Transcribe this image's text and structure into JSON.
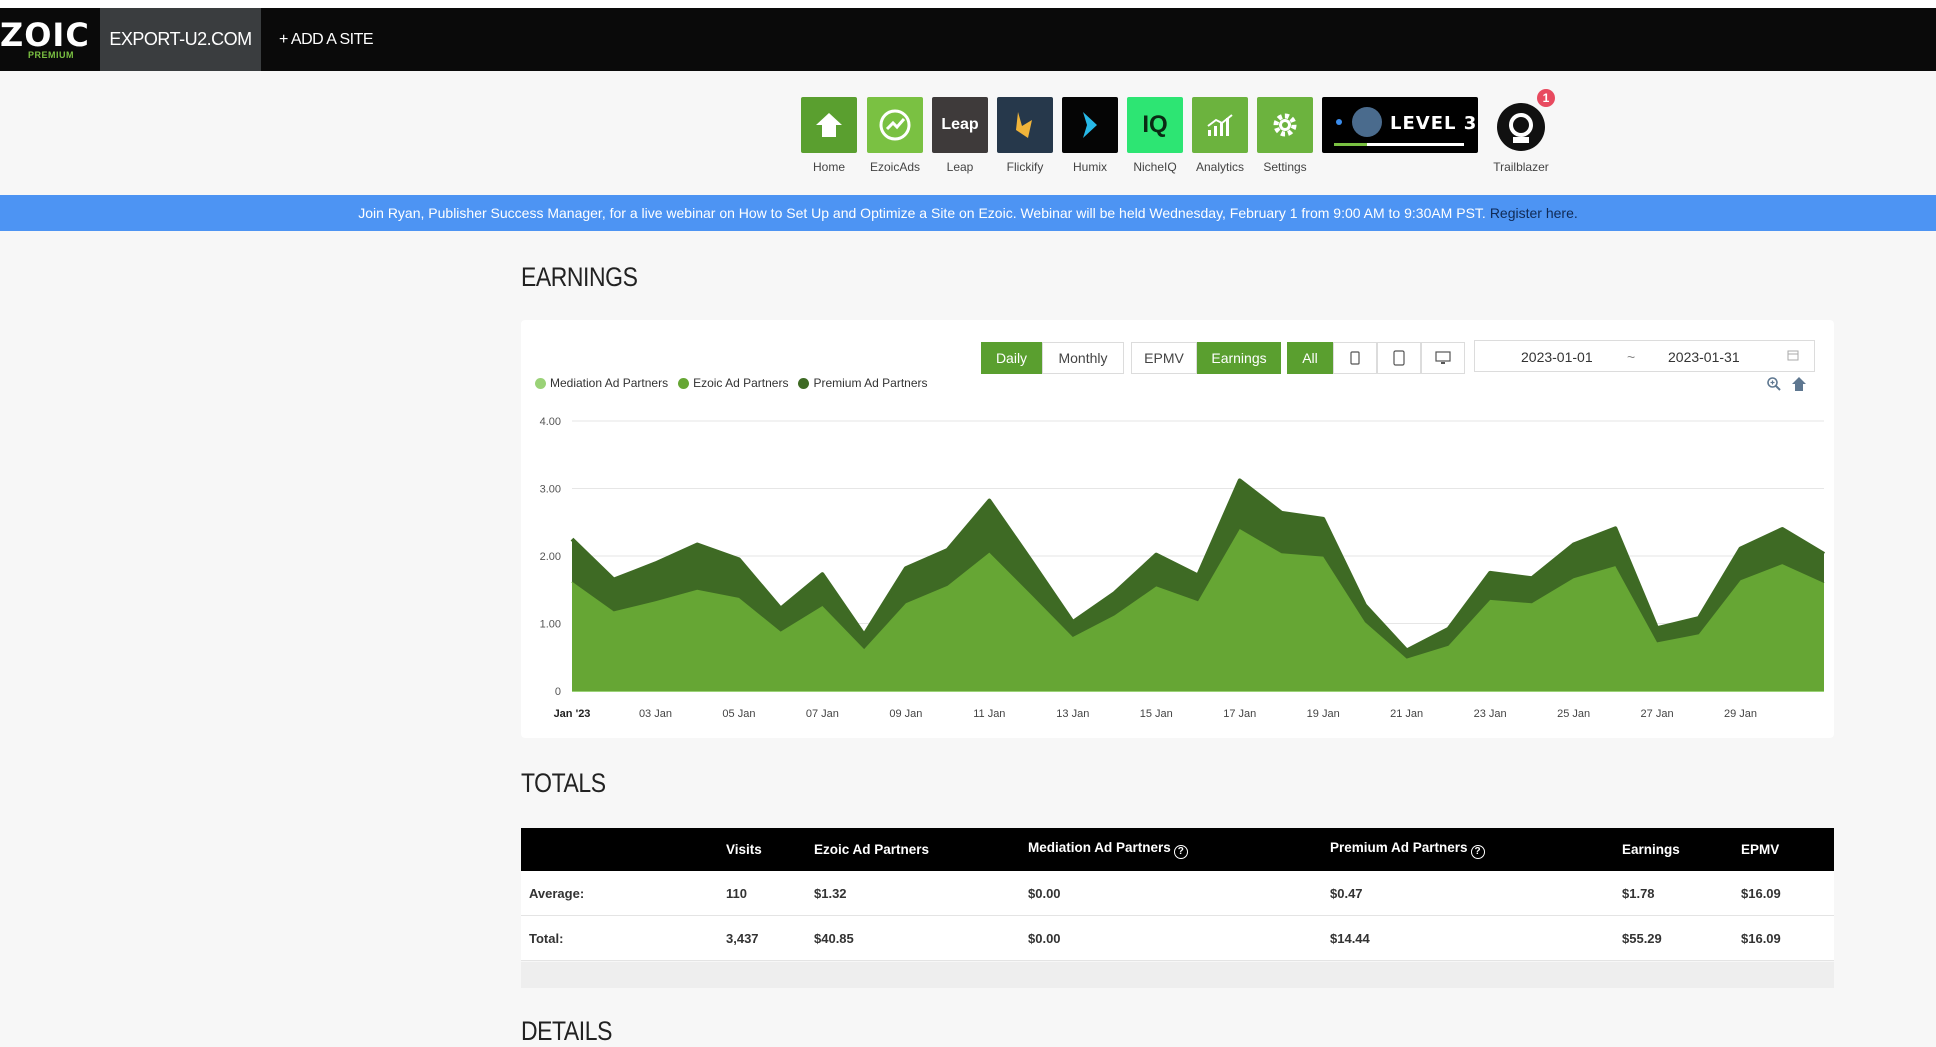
{
  "topbar": {
    "logo_text": "ZOIC",
    "logo_sub": "PREMIUM",
    "site": "EXPORT-U2.COM",
    "add_site": "+ ADD A SITE"
  },
  "apps": [
    {
      "label": "Home",
      "icon": "home-icon",
      "color": "#5a9f2f"
    },
    {
      "label": "EzoicAds",
      "icon": "ezoicads-icon",
      "color": "#7ac142"
    },
    {
      "label": "Leap",
      "icon": "leap-icon",
      "color": "#3e3a3a",
      "tile_text": "Leap"
    },
    {
      "label": "Flickify",
      "icon": "flickify-icon",
      "color": "#26384b"
    },
    {
      "label": "Humix",
      "icon": "humix-icon",
      "color": "#050505"
    },
    {
      "label": "NicheIQ",
      "icon": "nicheiq-icon",
      "color": "#2de573",
      "tile_text": "IQ"
    },
    {
      "label": "Analytics",
      "icon": "analytics-icon",
      "color": "#6cb33e"
    },
    {
      "label": "Settings",
      "icon": "settings-icon",
      "color": "#6cb33e"
    }
  ],
  "level": {
    "text": "LEVEL 3",
    "progress": 0.25
  },
  "trailblazer": {
    "label": "Trailblazer",
    "badge": "1"
  },
  "banner": {
    "text": "Join Ryan, Publisher Success Manager, for a live webinar on How to Set Up and Optimize a Site on Ezoic. Webinar will be held Wednesday, February 1 from 9:00 AM to 9:30AM PST.",
    "link": "Register here."
  },
  "earnings": {
    "title": "EARNINGS",
    "period_buttons": [
      "Daily",
      "Monthly"
    ],
    "metric_buttons": [
      "EPMV",
      "Earnings"
    ],
    "device_all": "All",
    "device_icons": [
      "tablet-icon",
      "mobile-icon",
      "desktop-icon"
    ],
    "date_from": "2023-01-01",
    "date_sep": "~",
    "date_to": "2023-01-31"
  },
  "chart_data": {
    "type": "area",
    "stacked": true,
    "legend_position": "top-left",
    "grid": true,
    "ylim": [
      0,
      4
    ],
    "y_ticks": [
      "0",
      "1.00",
      "2.00",
      "3.00",
      "4.00"
    ],
    "x_tick_labels": [
      "Jan '23",
      "03 Jan",
      "05 Jan",
      "07 Jan",
      "09 Jan",
      "11 Jan",
      "13 Jan",
      "15 Jan",
      "17 Jan",
      "19 Jan",
      "21 Jan",
      "23 Jan",
      "25 Jan",
      "27 Jan",
      "29 Jan"
    ],
    "x": [
      1,
      2,
      3,
      4,
      5,
      6,
      7,
      8,
      9,
      10,
      11,
      12,
      13,
      14,
      15,
      16,
      17,
      18,
      19,
      20,
      21,
      22,
      23,
      24,
      25,
      26,
      27,
      28,
      29,
      30,
      31
    ],
    "series": [
      {
        "name": "Mediation Ad Partners",
        "color": "#9ad277",
        "values": [
          0,
          0,
          0,
          0,
          0,
          0,
          0,
          0,
          0,
          0,
          0,
          0,
          0,
          0,
          0,
          0,
          0,
          0,
          0,
          0,
          0,
          0,
          0,
          0,
          0,
          0,
          0,
          0,
          0,
          0,
          0
        ]
      },
      {
        "name": "Ezoic Ad Partners",
        "color": "#66a634",
        "values": [
          1.62,
          1.18,
          1.33,
          1.5,
          1.38,
          0.88,
          1.26,
          0.62,
          1.3,
          1.56,
          2.05,
          1.43,
          0.8,
          1.12,
          1.55,
          1.33,
          2.4,
          2.04,
          1.99,
          1.02,
          0.48,
          0.67,
          1.35,
          1.3,
          1.67,
          1.85,
          0.72,
          0.84,
          1.64,
          1.88,
          1.6
        ]
      },
      {
        "name": "Premium Ad Partners",
        "color": "#3e6a24",
        "values": [
          0.63,
          0.47,
          0.56,
          0.67,
          0.57,
          0.34,
          0.47,
          0.21,
          0.52,
          0.53,
          0.77,
          0.5,
          0.22,
          0.33,
          0.47,
          0.38,
          0.72,
          0.6,
          0.56,
          0.25,
          0.12,
          0.25,
          0.4,
          0.37,
          0.5,
          0.56,
          0.21,
          0.24,
          0.47,
          0.52,
          0.43
        ]
      }
    ]
  },
  "totals": {
    "title": "TOTALS",
    "columns": [
      "",
      "Visits",
      "Ezoic Ad Partners",
      "Mediation Ad Partners",
      "Premium Ad Partners",
      "Earnings",
      "EPMV"
    ],
    "rows": [
      [
        "Average:",
        "110",
        "$1.32",
        "$0.00",
        "$0.47",
        "$1.78",
        "$16.09"
      ],
      [
        "Total:",
        "3,437",
        "$40.85",
        "$0.00",
        "$14.44",
        "$55.29",
        "$16.09"
      ]
    ]
  },
  "details": {
    "title": "DETAILS"
  }
}
